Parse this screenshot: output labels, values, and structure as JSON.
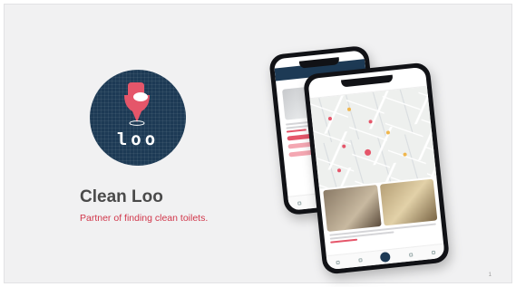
{
  "brand": {
    "logo_text": "loo",
    "colors": {
      "navy": "#1d3a55",
      "accent": "#e5566a",
      "text": "#4a4a4a"
    }
  },
  "title": "Clean Loo",
  "tagline": "Partner of finding clean toilets.",
  "page_number": "1",
  "phones": {
    "icons": [
      "toilet-icon",
      "map-pin-icon",
      "search-icon",
      "home-icon",
      "profile-icon"
    ]
  }
}
